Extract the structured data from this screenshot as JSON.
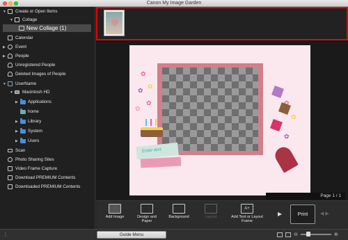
{
  "window": {
    "title": "Canon My Image Garden"
  },
  "sidebar": {
    "items": [
      {
        "label": "Create or Open Items",
        "icon": "create-icon"
      },
      {
        "label": "Collage",
        "icon": "collage-icon"
      },
      {
        "label": "New Collage (1)",
        "icon": "collage-doc-icon"
      },
      {
        "label": "Calendar",
        "icon": "calendar-icon"
      },
      {
        "label": "Event",
        "icon": "event-icon"
      },
      {
        "label": "People",
        "icon": "people-icon"
      },
      {
        "label": "Unregistered People",
        "icon": "person-icon"
      },
      {
        "label": "Deleted Images of People",
        "icon": "deleted-person-icon"
      },
      {
        "label": "UserName",
        "icon": "computer-icon"
      },
      {
        "label": "Macintosh HD",
        "icon": "drive-icon"
      },
      {
        "label": "Applications",
        "icon": "folder-icon"
      },
      {
        "label": "home",
        "icon": "folder-icon"
      },
      {
        "label": "Library",
        "icon": "folder-icon"
      },
      {
        "label": "System",
        "icon": "folder-icon"
      },
      {
        "label": "Users",
        "icon": "folder-icon"
      },
      {
        "label": "Scan",
        "icon": "scan-icon"
      },
      {
        "label": "Photo Sharing Sites",
        "icon": "globe-icon"
      },
      {
        "label": "Video Frame Capture",
        "icon": "video-icon"
      },
      {
        "label": "Download PREMIUM Contents",
        "icon": "download-icon"
      },
      {
        "label": "Downloaded PREMIUM Contents",
        "icon": "downloaded-icon"
      }
    ]
  },
  "canvas": {
    "placeholder_text": "Enter text.",
    "page_indicator": "Page 1 / 1"
  },
  "toolbar": {
    "add_image": "Add Image",
    "design_and_paper": "Design and Paper",
    "background": "Background",
    "layout": "Layout",
    "add_text": "Add Text or Layout Frame",
    "print": "Print"
  },
  "status": {
    "guide_menu": "Guide Menu"
  },
  "colors": {
    "highlight": "#e00000",
    "frame": "#d17f8b",
    "page": "#fbe8ee",
    "folder": "#4a90d9"
  }
}
